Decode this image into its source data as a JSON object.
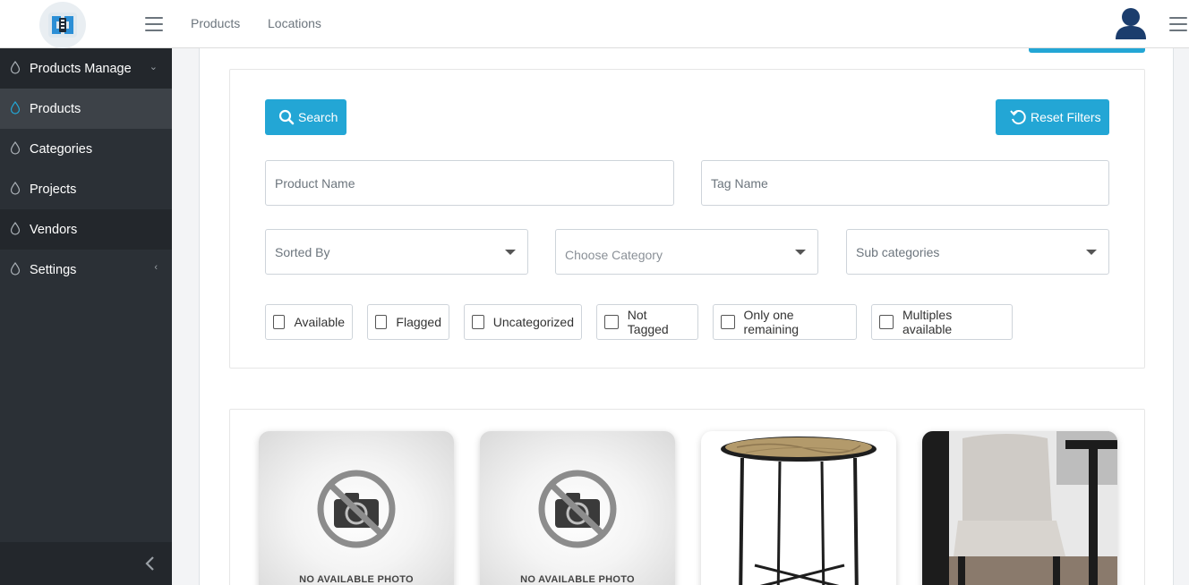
{
  "header": {
    "nav": [
      "Products",
      "Locations"
    ]
  },
  "sidebar": {
    "items": [
      {
        "label": "Products Manage",
        "chevron": "chevron-down"
      },
      {
        "label": "Products"
      },
      {
        "label": "Categories"
      },
      {
        "label": "Projects"
      },
      {
        "label": "Vendors"
      },
      {
        "label": "Settings",
        "chevron": "chevron-left"
      }
    ],
    "active": "Products"
  },
  "filters": {
    "search_label": "Search",
    "reset_label": "Reset Filters",
    "product_name_placeholder": "Product Name",
    "tag_name_placeholder": "Tag Name",
    "sorted_by": "Sorted By",
    "category": "Choose Category",
    "subcategories": "Sub categories",
    "checkboxes": [
      "Available",
      "Flagged",
      "Uncategorized",
      "Not Tagged",
      "Only one remaining",
      "Multiples available"
    ]
  },
  "products": [
    {
      "image": "no-photo",
      "caption": "NO AVAILABLE PHOTO"
    },
    {
      "image": "no-photo",
      "caption": "NO AVAILABLE PHOTO"
    },
    {
      "image": "round-side-table"
    },
    {
      "image": "upholstered-dining-chair"
    }
  ],
  "colors": {
    "accent": "#23a6d5",
    "sidebar_bg": "#2b3036",
    "sidebar_active": "#3d4248",
    "avatar": "#1b3d6d"
  }
}
